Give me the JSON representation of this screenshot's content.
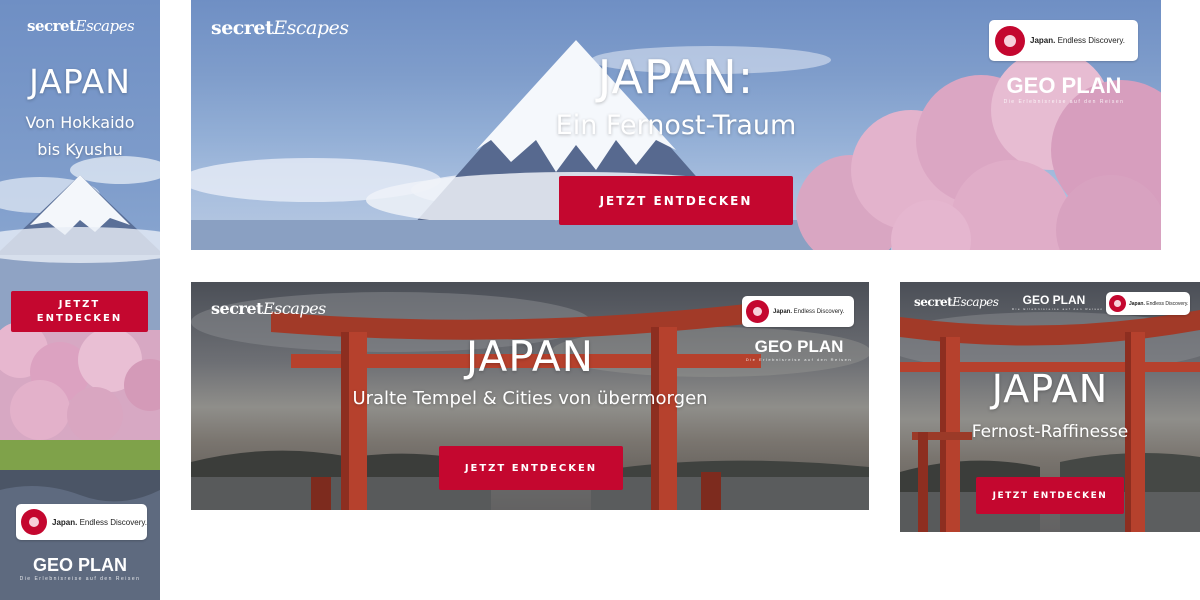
{
  "brand": {
    "part1": "secret",
    "part2": "Escapes"
  },
  "partner": {
    "badge_strong": "Japan.",
    "badge_rest": " Endless Discovery.",
    "geoplan": "GEO PLAN",
    "geoplan_tag": "Die Erlebnisreise auf den Reisen"
  },
  "cta": {
    "label": "JETZT ENTDECKEN",
    "label_line1": "JETZT",
    "label_line2": "ENTDECKEN"
  },
  "skyscraper": {
    "title": "JAPAN",
    "subtitle_line1": "Von Hokkaido",
    "subtitle_line2": "bis Kyushu"
  },
  "leaderboard": {
    "title": "JAPAN:",
    "subtitle": "Ein Fernost-Traum"
  },
  "wide": {
    "title": "JAPAN",
    "subtitle": "Uralte Tempel & Cities von übermorgen"
  },
  "rectangle": {
    "title": "JAPAN",
    "subtitle": "Fernost-Raffinesse"
  },
  "colors": {
    "cta_red": "#c4072f",
    "sky_blue": "#7f9dcb",
    "blossom_pink": "#e7b7cf",
    "torii_red": "#b6412d"
  }
}
